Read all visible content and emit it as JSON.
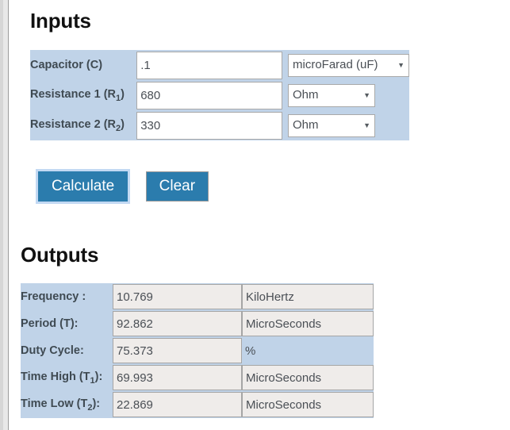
{
  "inputs": {
    "title": "Inputs",
    "rows": [
      {
        "label_main": "Capacitor (C)",
        "label_base": "Capacitor (C)",
        "label_sub": "",
        "value": ".1",
        "unit": "microFarad (uF)",
        "caret": "▼"
      },
      {
        "label_main": "Resistance 1 (R1)",
        "label_base": "Resistance 1 (R",
        "label_sub": "1",
        "label_tail": ")",
        "value": "680",
        "unit": "Ohm",
        "caret": "▼"
      },
      {
        "label_main": "Resistance 2 (R2)",
        "label_base": "Resistance 2 (R",
        "label_sub": "2",
        "label_tail": ")",
        "value": "330",
        "unit": "Ohm",
        "caret": "▼"
      }
    ]
  },
  "buttons": {
    "calculate": "Calculate",
    "clear": "Clear"
  },
  "outputs": {
    "title": "Outputs",
    "rows": [
      {
        "label_base": "Frequency :",
        "label_sub": "",
        "label_tail": "",
        "value": "10.769",
        "unit": "KiloHertz",
        "unit_is_input": true
      },
      {
        "label_base": "Period (T):",
        "label_sub": "",
        "label_tail": "",
        "value": "92.862",
        "unit": "MicroSeconds",
        "unit_is_input": true
      },
      {
        "label_base": "Duty Cycle:",
        "label_sub": "",
        "label_tail": "",
        "value": "75.373",
        "unit": "%",
        "unit_is_input": false
      },
      {
        "label_base": "Time High (T",
        "label_sub": "1",
        "label_tail": "):",
        "value": "69.993",
        "unit": "MicroSeconds",
        "unit_is_input": true
      },
      {
        "label_base": "Time Low (T",
        "label_sub": "2",
        "label_tail": "):",
        "value": "22.869",
        "unit": "MicroSeconds",
        "unit_is_input": true
      }
    ]
  },
  "colors": {
    "table_blue": "#c0d3e8",
    "button_blue": "#2b7cad",
    "readonly_bg": "#efecea",
    "focus_ring": "#c3d9f3"
  }
}
